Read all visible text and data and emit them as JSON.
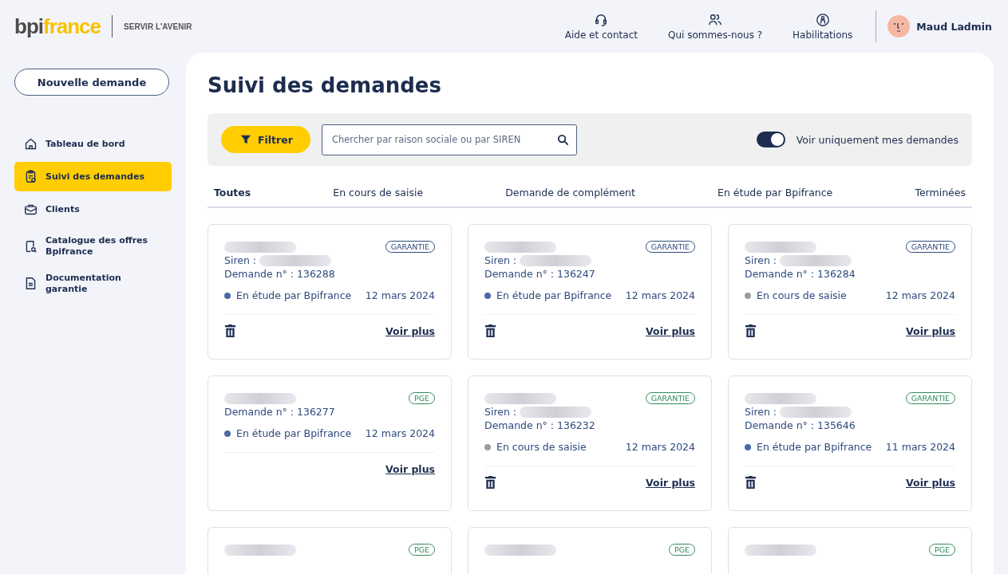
{
  "header": {
    "logo": {
      "brand_start": "bpi",
      "brand_end": "france",
      "tagline": "SERVIR L'AVENIR"
    },
    "nav": [
      {
        "kind": "headset",
        "label": "Aide et contact"
      },
      {
        "kind": "people",
        "label": "Qui sommes-nous ?"
      },
      {
        "kind": "badge",
        "label": "Habilitations"
      }
    ],
    "user": {
      "name": "Maud Ladmin"
    }
  },
  "sidebar": {
    "new_button": "Nouvelle demande",
    "items": [
      {
        "kind": "home",
        "label": "Tableau de bord",
        "selected": false
      },
      {
        "kind": "clipboard",
        "label": "Suivi des demandes",
        "selected": true
      },
      {
        "kind": "briefcase",
        "label": "Clients",
        "selected": false
      },
      {
        "kind": "catalog",
        "label": "Catalogue des offres Bpifrance",
        "selected": false
      },
      {
        "kind": "document",
        "label": "Documentation garantie",
        "selected": false
      }
    ]
  },
  "page": {
    "title": "Suivi des demandes",
    "filter_button": "Filtrer",
    "search": {
      "placeholder": "Chercher par raison sociale ou par SIREN"
    },
    "toggle": {
      "on": true,
      "label": "Voir uniquement mes demandes"
    },
    "tabs": [
      {
        "label": "Toutes",
        "selected": true
      },
      {
        "label": "En cours de saisie",
        "selected": false
      },
      {
        "label": "Demande de complément",
        "selected": false
      },
      {
        "label": "En étude par Bpifrance",
        "selected": false
      },
      {
        "label": "Terminées",
        "selected": false
      }
    ],
    "cards": [
      {
        "tag": {
          "label": "GARANTIE",
          "color": "#2e4a7e"
        },
        "siren_label": "Siren :",
        "number": "Demande n° : 136288",
        "status": "En étude par Bpifrance",
        "color": "#4a69a6",
        "date": "12 mars 2024",
        "deletable": true,
        "link": "Voir plus"
      },
      {
        "tag": {
          "label": "GARANTIE",
          "color": "#2e4a7e"
        },
        "siren_label": "Siren :",
        "number": "Demande n° : 136247",
        "status": "En étude par Bpifrance",
        "color": "#4a69a6",
        "date": "12 mars 2024",
        "deletable": true,
        "link": "Voir plus"
      },
      {
        "tag": {
          "label": "GARANTIE",
          "color": "#2e4a7e"
        },
        "siren_label": "Siren :",
        "number": "Demande n° : 136284",
        "status": "En cours de saisie",
        "color": "#a19c99",
        "date": "12 mars 2024",
        "deletable": true,
        "link": "Voir plus"
      },
      {
        "tag": {
          "label": "PGE",
          "color": "#2f8a5a"
        },
        "number": "Demande n° : 136277",
        "status": "En étude par Bpifrance",
        "color": "#4a69a6",
        "date": "12 mars 2024",
        "deletable": false,
        "link": "Voir plus"
      },
      {
        "tag": {
          "label": "GARANTIE",
          "color": "#2f8a5a"
        },
        "siren_label": "Siren :",
        "number": "Demande n° : 136232",
        "status": "En cours de saisie",
        "color": "#a19c99",
        "date": "12 mars 2024",
        "deletable": true,
        "link": "Voir plus"
      },
      {
        "tag": {
          "label": "GARANTIE",
          "color": "#2f8a5a"
        },
        "siren_label": "Siren :",
        "number": "Demande n° : 135646",
        "status": "En étude par Bpifrance",
        "color": "#4a69a6",
        "date": "11 mars 2024",
        "deletable": true,
        "link": "Voir plus"
      },
      {
        "tag": {
          "label": "PGE",
          "color": "#2f8a5a"
        }
      },
      {
        "tag": {
          "label": "PGE",
          "color": "#2f8a5a"
        }
      },
      {
        "tag": {
          "label": "PGE",
          "color": "#2f8a5a"
        }
      }
    ]
  }
}
